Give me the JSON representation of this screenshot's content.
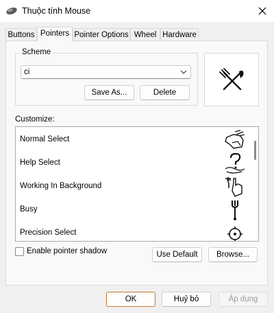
{
  "window": {
    "title": "Thuộc tính Mouse",
    "title_icon": "mouse-icon",
    "close_icon": "close-icon"
  },
  "tabs": [
    {
      "label": "Buttons",
      "active": false
    },
    {
      "label": "Pointers",
      "active": true
    },
    {
      "label": "Pointer Options",
      "active": false
    },
    {
      "label": "Wheel",
      "active": false
    },
    {
      "label": "Hardware",
      "active": false
    }
  ],
  "scheme": {
    "group_label": "Scheme",
    "selected": "ci",
    "save_as_label": "Save As...",
    "delete_label": "Delete",
    "preview_icon": "fork-knife-icon"
  },
  "customize": {
    "label": "Customize:",
    "rows": [
      {
        "label": "Normal Select",
        "icon": "pointing-hand-icon"
      },
      {
        "label": "Help Select",
        "icon": "hand-question-icon"
      },
      {
        "label": "Working In Background",
        "icon": "hand-fork-icon"
      },
      {
        "label": "Busy",
        "icon": "fork-icon"
      },
      {
        "label": "Precision Select",
        "icon": "crosshair-icon"
      }
    ]
  },
  "pointer_shadow": {
    "label": "Enable pointer shadow",
    "checked": false
  },
  "buttons": {
    "use_default": "Use Default",
    "browse": "Browse..."
  },
  "footer": {
    "ok": "OK",
    "cancel": "Huỷ bỏ",
    "apply": "Áp dụng"
  },
  "colors": {
    "ok_border": "#c57a2c",
    "disabled_text": "#9d9d9d"
  }
}
